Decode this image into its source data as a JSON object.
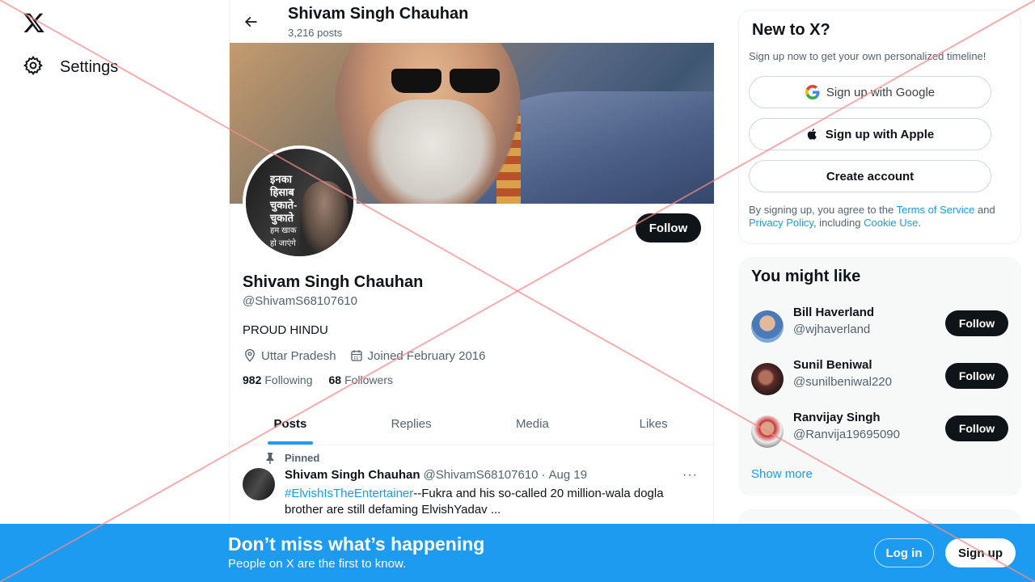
{
  "nav": {
    "settings_label": "Settings"
  },
  "header": {
    "name": "Shivam Singh Chauhan",
    "posts_count": "3,216 posts"
  },
  "profile": {
    "avatar_text": [
      "इनका",
      "हिसाब",
      "चुकाते-",
      "चुकाते",
      "हम खाक",
      "हो जाएंगे"
    ],
    "follow_label": "Follow",
    "name": "Shivam Singh Chauhan",
    "handle": "@ShivamS68107610",
    "bio": "PROUD HINDU",
    "location": "Uttar Pradesh",
    "joined": "Joined February 2016",
    "following_count": "982",
    "following_label": "Following",
    "followers_count": "68",
    "followers_label": "Followers"
  },
  "tabs": [
    {
      "label": "Posts",
      "active": true
    },
    {
      "label": "Replies",
      "active": false
    },
    {
      "label": "Media",
      "active": false
    },
    {
      "label": "Likes",
      "active": false
    }
  ],
  "tweet": {
    "pinned_label": "Pinned",
    "author_name": "Shivam Singh Chauhan",
    "author_handle": "@ShivamS68107610",
    "separator": "·",
    "date": "Aug 19",
    "more": "···",
    "hashtag": "#ElvishIsTheEntertainer",
    "text_line1": "--Fukra and his so-called 20 million-wala dogla",
    "text_line2": "brother are still defaming ElvishYadav ..."
  },
  "signup_card": {
    "title": "New to X?",
    "subtitle": "Sign up now to get your own personalized timeline!",
    "google_label": "Sign up with Google",
    "apple_label": "Sign up with Apple",
    "create_label": "Create account",
    "terms_prefix": "By signing up, you agree to the ",
    "terms_link": "Terms of Service",
    "terms_and": " and ",
    "privacy_link": "Privacy Policy",
    "terms_including": ", including ",
    "cookie_link": "Cookie Use",
    "terms_end": "."
  },
  "suggestions": {
    "title": "You might like",
    "users": [
      {
        "name": "Bill Haverland",
        "handle": "@wjhaverland",
        "follow": "Follow"
      },
      {
        "name": "Sunil Beniwal",
        "handle": "@sunilbeniwal220",
        "follow": "Follow"
      },
      {
        "name": "Ranvijay Singh",
        "handle": "@Ranvija19695090",
        "follow": "Follow"
      }
    ],
    "show_more": "Show more"
  },
  "bottom_bar": {
    "title": "Don’t miss what’s happening",
    "subtitle": "People on X are the first to know.",
    "login_label": "Log in",
    "signup_label": "Sign up"
  },
  "colors": {
    "accent": "#1d9bf0",
    "text_primary": "#0f1419",
    "text_secondary": "#536471",
    "overlay_x": "#f28b8b"
  },
  "icons": [
    "x-logo-icon",
    "gear-icon",
    "back-arrow-icon",
    "location-pin-icon",
    "calendar-icon",
    "pin-icon",
    "more-icon",
    "google-icon",
    "apple-icon"
  ]
}
